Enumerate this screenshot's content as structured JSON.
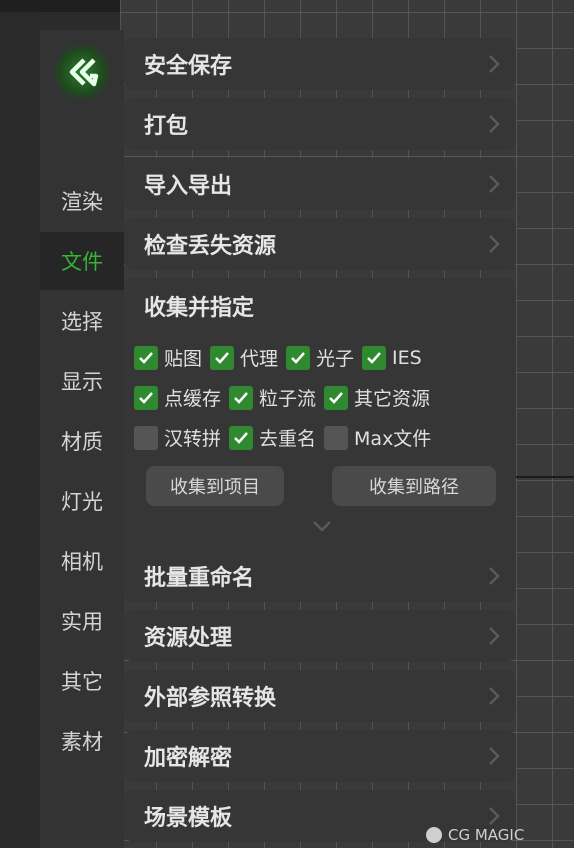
{
  "logo": {
    "icon": "cg-logo-icon"
  },
  "categories": [
    {
      "label": "",
      "state": "dim"
    },
    {
      "label": "渲染",
      "state": "normal"
    },
    {
      "label": "文件",
      "state": "active"
    },
    {
      "label": "选择",
      "state": "normal"
    },
    {
      "label": "显示",
      "state": "normal"
    },
    {
      "label": "材质",
      "state": "normal"
    },
    {
      "label": "灯光",
      "state": "normal"
    },
    {
      "label": "相机",
      "state": "normal"
    },
    {
      "label": "实用",
      "state": "normal"
    },
    {
      "label": "其它",
      "state": "normal"
    },
    {
      "label": "素材",
      "state": "normal"
    }
  ],
  "menu": {
    "safe_save": "安全保存",
    "pack": "打包",
    "import_export": "导入导出",
    "check_missing": "检查丢失资源",
    "batch_rename": "批量重命名",
    "resource_process": "资源处理",
    "xref_convert": "外部参照转换",
    "encrypt": "加密解密",
    "scene_template": "场景模板"
  },
  "collect": {
    "title": "收集并指定",
    "options": {
      "texture": {
        "label": "贴图",
        "checked": true
      },
      "proxy": {
        "label": "代理",
        "checked": true
      },
      "photon": {
        "label": "光子",
        "checked": true
      },
      "ies": {
        "label": "IES",
        "checked": true
      },
      "point_cache": {
        "label": "点缓存",
        "checked": true
      },
      "particle_flow": {
        "label": "粒子流",
        "checked": true
      },
      "other_res": {
        "label": "其它资源",
        "checked": true
      },
      "pinyin": {
        "label": "汉转拼",
        "checked": false
      },
      "dedupe": {
        "label": "去重名",
        "checked": true
      },
      "max_file": {
        "label": "Max文件",
        "checked": false
      }
    },
    "btn_project": "收集到项目",
    "btn_path": "收集到路径"
  },
  "watermark": "CG MAGIC",
  "colors": {
    "accent": "#35b535",
    "check_bg": "#2f8a2f",
    "panel": "#363636"
  }
}
